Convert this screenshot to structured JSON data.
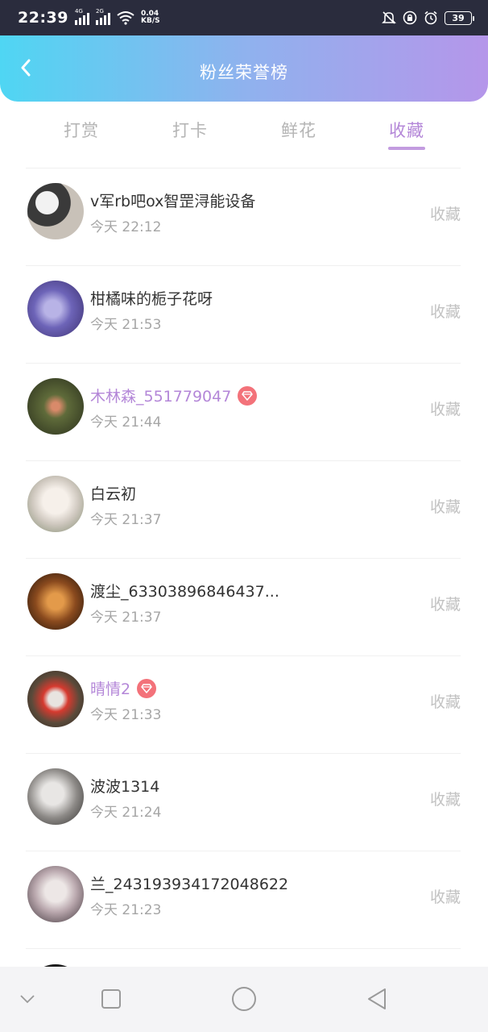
{
  "status_bar": {
    "time": "22:39",
    "net1": "4G",
    "net2": "2G",
    "speed_value": "0.04",
    "speed_unit": "KB/S",
    "battery": "39"
  },
  "header": {
    "title": "粉丝荣誉榜"
  },
  "tabs": [
    {
      "label": "打赏",
      "active": false
    },
    {
      "label": "打卡",
      "active": false
    },
    {
      "label": "鲜花",
      "active": false
    },
    {
      "label": "收藏",
      "active": true
    }
  ],
  "list": [
    {
      "name": "v军rb吧ox智罡浔能设备",
      "time": "今天 22:12",
      "action": "收藏",
      "vip": false
    },
    {
      "name": "柑橘味的栀子花呀",
      "time": "今天 21:53",
      "action": "收藏",
      "vip": false
    },
    {
      "name": "木林森_551779047",
      "time": "今天 21:44",
      "action": "收藏",
      "vip": true
    },
    {
      "name": "白云初",
      "time": "今天 21:37",
      "action": "收藏",
      "vip": false
    },
    {
      "name": "渡尘_63303896846437...",
      "time": "今天 21:37",
      "action": "收藏",
      "vip": false
    },
    {
      "name": "晴情2",
      "time": "今天 21:33",
      "action": "收藏",
      "vip": true
    },
    {
      "name": "波波1314",
      "time": "今天 21:24",
      "action": "收藏",
      "vip": false
    },
    {
      "name": "兰_243193934172048622",
      "time": "今天 21:23",
      "action": "收藏",
      "vip": false
    }
  ],
  "colors": {
    "header_gradient_start": "#4fd6f3",
    "header_gradient_end": "#b596ea",
    "accent": "#b487d8",
    "vip_badge": "#f3727a"
  },
  "icons": {
    "back": "back-arrow-icon",
    "vip": "diamond-icon",
    "nav_down": "chevron-down-icon",
    "nav_recent": "square-icon",
    "nav_home": "circle-icon",
    "nav_back": "triangle-back-icon"
  }
}
